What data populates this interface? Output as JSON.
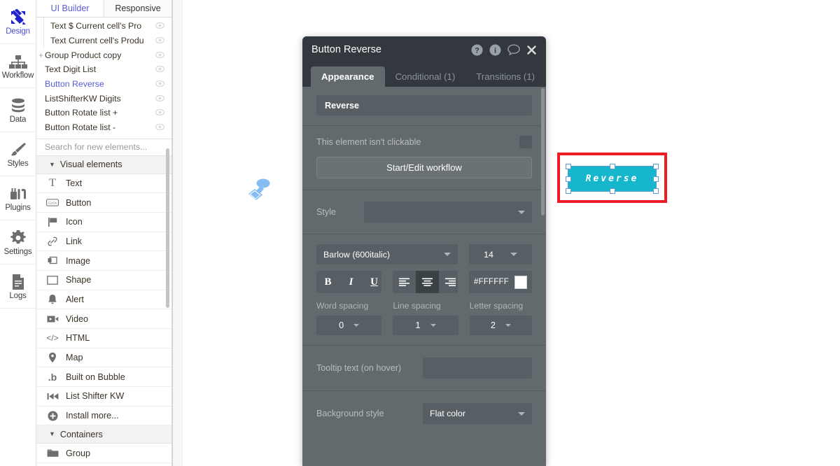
{
  "rail": {
    "items": [
      {
        "label": "Design",
        "icon": "design-icon",
        "active": true
      },
      {
        "label": "Workflow",
        "icon": "workflow-icon",
        "active": false
      },
      {
        "label": "Data",
        "icon": "data-icon",
        "active": false
      },
      {
        "label": "Styles",
        "icon": "styles-brush-icon",
        "active": false
      },
      {
        "label": "Plugins",
        "icon": "plugins-icon",
        "active": false
      },
      {
        "label": "Settings",
        "icon": "gear-icon",
        "active": false
      },
      {
        "label": "Logs",
        "icon": "logs-document-icon",
        "active": false
      }
    ]
  },
  "tabs": {
    "ui_builder": "UI Builder",
    "responsive": "Responsive"
  },
  "tree": {
    "rows": [
      {
        "label": "Text $ Current cell's Pro",
        "indent": true,
        "plus": false,
        "selected": false,
        "eye": "eye-icon"
      },
      {
        "label": "Text Current cell's Produ",
        "indent": true,
        "plus": false,
        "selected": false,
        "eye": "eye-icon"
      },
      {
        "label": "Group Product copy",
        "indent": false,
        "plus": true,
        "selected": false,
        "eye": "eye-icon"
      },
      {
        "label": "Text Digit List",
        "indent": false,
        "plus": false,
        "selected": false,
        "eye": "eye-icon"
      },
      {
        "label": "Button Reverse",
        "indent": false,
        "plus": false,
        "selected": true,
        "eye": "eye-icon"
      },
      {
        "label": "ListShifterKW Digits",
        "indent": false,
        "plus": false,
        "selected": false,
        "eye": "eye-icon"
      },
      {
        "label": "Button Rotate list +",
        "indent": false,
        "plus": false,
        "selected": false,
        "eye": "eye-icon"
      },
      {
        "label": "Button Rotate list -",
        "indent": false,
        "plus": false,
        "selected": false,
        "eye": "eye-icon"
      }
    ],
    "search_placeholder": "Search for new elements..."
  },
  "palette": {
    "sections": [
      {
        "title": "Visual elements",
        "items": [
          {
            "label": "Text",
            "icon": "text-t-icon"
          },
          {
            "label": "Button",
            "icon": "button-click-icon"
          },
          {
            "label": "Icon",
            "icon": "flag-icon"
          },
          {
            "label": "Link",
            "icon": "link-chain-icon"
          },
          {
            "label": "Image",
            "icon": "image-icon"
          },
          {
            "label": "Shape",
            "icon": "shape-rectangle-icon"
          },
          {
            "label": "Alert",
            "icon": "bell-alert-icon"
          },
          {
            "label": "Video",
            "icon": "video-camera-icon"
          },
          {
            "label": "HTML",
            "icon": "code-html-icon"
          },
          {
            "label": "Map",
            "icon": "map-pin-icon"
          },
          {
            "label": "Built on Bubble",
            "icon": "bubble-logo-icon"
          },
          {
            "label": "List Shifter KW",
            "icon": "list-shifter-icon"
          },
          {
            "label": "Install more...",
            "icon": "plus-circle-icon"
          }
        ]
      },
      {
        "title": "Containers",
        "items": [
          {
            "label": "Group",
            "icon": "folder-icon"
          }
        ]
      }
    ]
  },
  "property_editor": {
    "title": "Button Reverse",
    "header_icons": [
      {
        "name": "help-icon",
        "glyph": "?"
      },
      {
        "name": "info-icon",
        "glyph": "i"
      },
      {
        "name": "comment-icon",
        "glyph": "speech-bubble"
      },
      {
        "name": "close-icon",
        "glyph": "✕"
      }
    ],
    "tabs": [
      {
        "label": "Appearance",
        "active": true
      },
      {
        "label": "Conditional (1)",
        "active": false
      },
      {
        "label": "Transitions (1)",
        "active": false
      }
    ],
    "element_name": "Reverse",
    "clickable_label": "This element isn't clickable",
    "clickable_checked": false,
    "workflow_button": "Start/Edit workflow",
    "style_label": "Style",
    "style_value": "",
    "font_family": "Barlow (600italic)",
    "font_size": "14",
    "format_buttons": [
      {
        "name": "bold-button",
        "glyph": "B",
        "on": false
      },
      {
        "name": "italic-button",
        "glyph": "I",
        "on": false
      },
      {
        "name": "underline-button",
        "glyph": "U",
        "on": false
      }
    ],
    "align_buttons": [
      {
        "name": "align-left-button",
        "on": false
      },
      {
        "name": "align-center-button",
        "on": true
      },
      {
        "name": "align-right-button",
        "on": false
      }
    ],
    "font_color_hex": "#FFFFFF",
    "spacing_labels": {
      "word": "Word spacing",
      "line": "Line spacing",
      "letter": "Letter spacing"
    },
    "word_spacing": "0",
    "line_spacing": "1",
    "letter_spacing": "2",
    "tooltip_label": "Tooltip text (on hover)",
    "tooltip_value": "",
    "background_style_label": "Background style",
    "background_style_value": "Flat color"
  },
  "canvas": {
    "selected_element": {
      "name": "Button Reverse",
      "text": "Reverse",
      "bg_color": "#16B6CD",
      "text_color": "#FFFFFF"
    },
    "annotation_color": "#EE1C25",
    "cursor_icon": "paint-stamp-cursor-icon"
  }
}
